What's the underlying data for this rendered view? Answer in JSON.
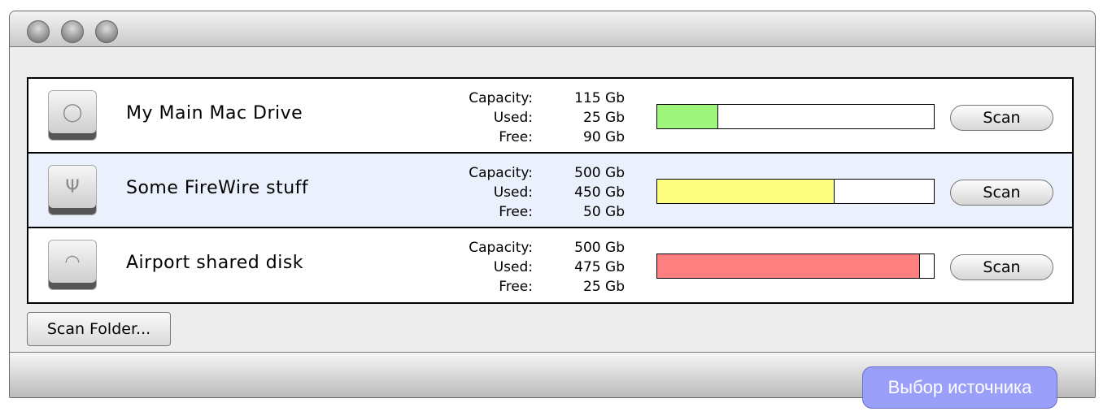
{
  "drives": [
    {
      "name": "My Main Mac Drive",
      "icon": "hard-drive-icon",
      "capacity": "115 Gb",
      "used": "25 Gb",
      "free": "90 Gb",
      "usage_fill": 0.22,
      "bar_color": "#9ef57c",
      "scan": "Scan",
      "selected": false
    },
    {
      "name": "Some FireWire stuff",
      "icon": "firewire-drive-icon",
      "capacity": "500 Gb",
      "used": "450 Gb",
      "free": "50 Gb",
      "usage_fill": 0.64,
      "bar_color": "#fdfd80",
      "scan": "Scan",
      "selected": true
    },
    {
      "name": "Airport shared disk",
      "icon": "wifi-drive-icon",
      "capacity": "500 Gb",
      "used": "475 Gb",
      "free": "25 Gb",
      "usage_fill": 0.95,
      "bar_color": "#fd7f7f",
      "scan": "Scan",
      "selected": false
    }
  ],
  "labels": {
    "capacity": "Capacity:",
    "used": "Used:",
    "free": "Free:"
  },
  "scan_folder": "Scan Folder...",
  "badge": "Выбор источника"
}
